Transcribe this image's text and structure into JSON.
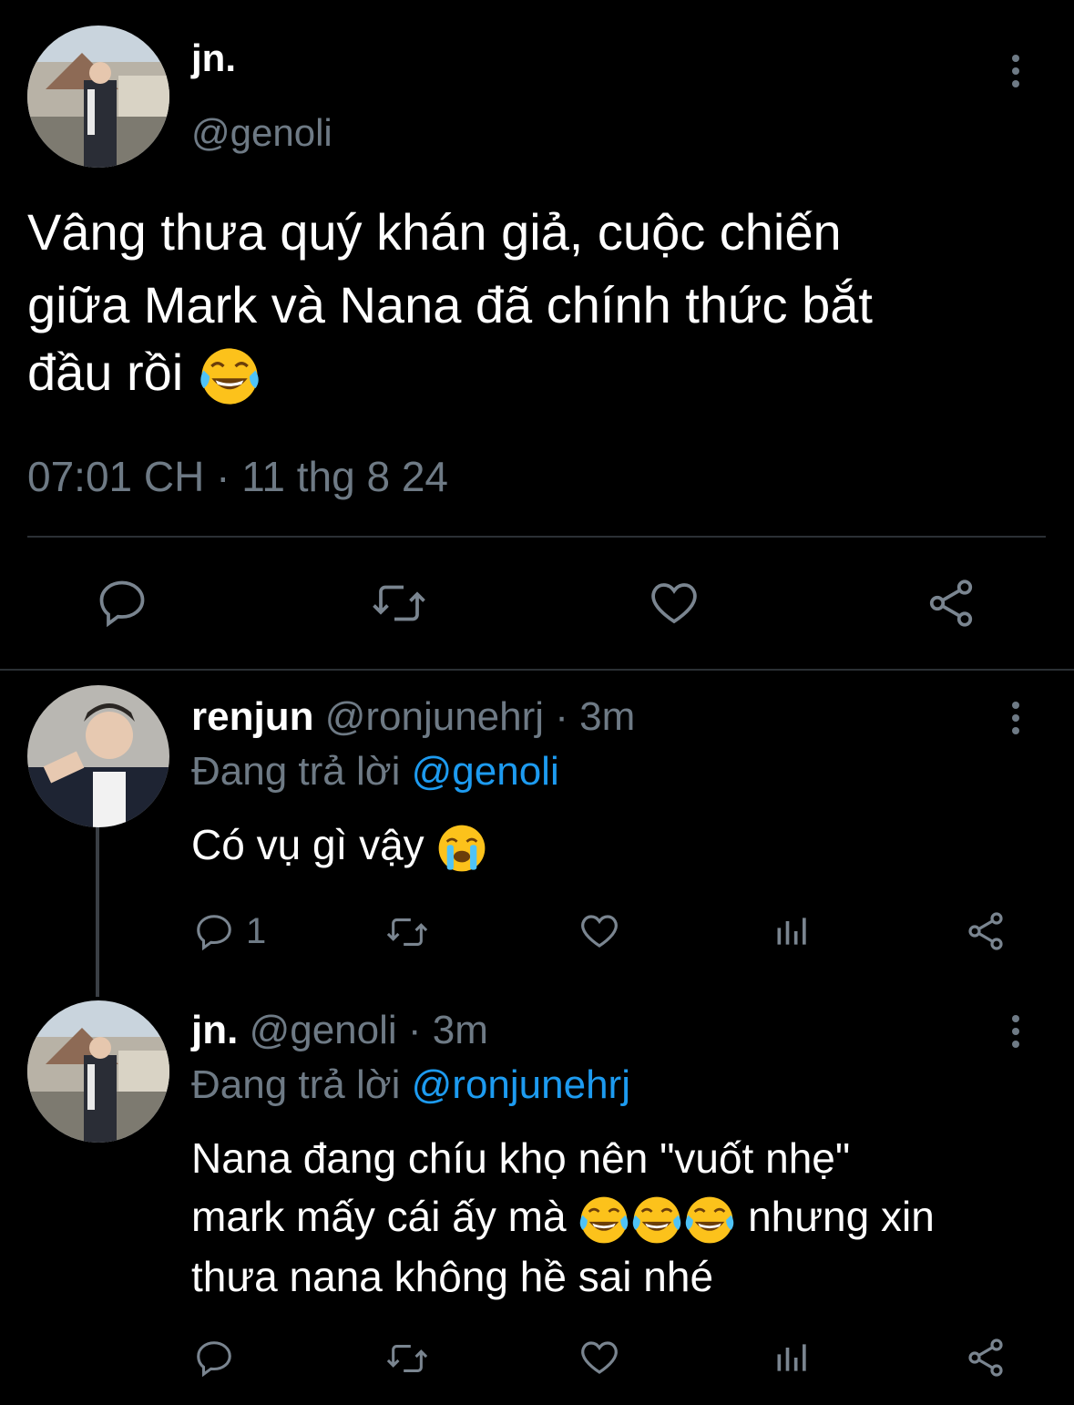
{
  "main_tweet": {
    "display_name": "jn.",
    "handle": "@genoli",
    "text_line1": "Vâng thưa quý khán giả, cuộc chiến",
    "text_line2": "giữa Mark và Nana đã chính thức bắt",
    "text_line3": "đầu rồi",
    "timestamp": "07:01 CH · 11 thg 8 24",
    "emoji_icon": "face-with-tears-of-joy"
  },
  "reply1": {
    "display_name": "renjun",
    "handle": "@ronjunehrj",
    "time": "· 3m",
    "replying_label": "Đang trả lời",
    "replying_to": "@genoli",
    "text": "Có vụ gì vậy",
    "reply_count": "1",
    "emoji_icon": "loudly-crying-face"
  },
  "reply2": {
    "display_name": "jn.",
    "handle": "@genoli",
    "time": "· 3m",
    "replying_label": "Đang trả lời",
    "replying_to": "@ronjunehrj",
    "text_line1": "Nana đang chíu khọ nên \"vuốt nhẹ\"",
    "text_line2a": "mark mấy cái ấy mà",
    "text_line2b": "nhưng xin",
    "text_line3": "thưa nana không hề sai nhé",
    "emoji_icon": "face-with-tears-of-joy"
  },
  "colors": {
    "background": "#000000",
    "muted_text": "#6e7a85",
    "link": "#1d9bf0",
    "divider": "#2b3035"
  }
}
